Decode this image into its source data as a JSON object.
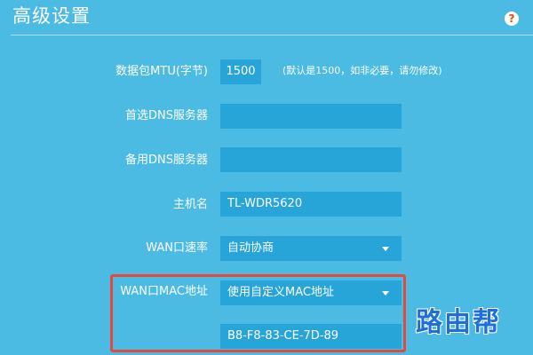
{
  "header": {
    "title": "高级设置",
    "help_icon": "help-icon",
    "help_text": "?"
  },
  "form": {
    "mtu": {
      "label": "数据包MTU(字节)",
      "value": "1500",
      "hint": "(默认是1500，如非必要，请勿修改)"
    },
    "primary_dns": {
      "label": "首选DNS服务器",
      "value": ""
    },
    "secondary_dns": {
      "label": "备用DNS服务器",
      "value": ""
    },
    "hostname": {
      "label": "主机名",
      "value": "TL-WDR5620"
    },
    "wan_speed": {
      "label": "WAN口速率",
      "selected": "自动协商"
    },
    "wan_mac": {
      "label": "WAN口MAC地址",
      "selected": "使用自定义MAC地址",
      "mac_value": "B8-F8-83-CE-7D-89"
    }
  },
  "watermark": "路由帮",
  "colors": {
    "background": "#4bbbe3",
    "field": "#27a5d9",
    "highlight_border": "#e8483a",
    "help_icon": "#e84a1f",
    "watermark": "#1f6fd6"
  }
}
